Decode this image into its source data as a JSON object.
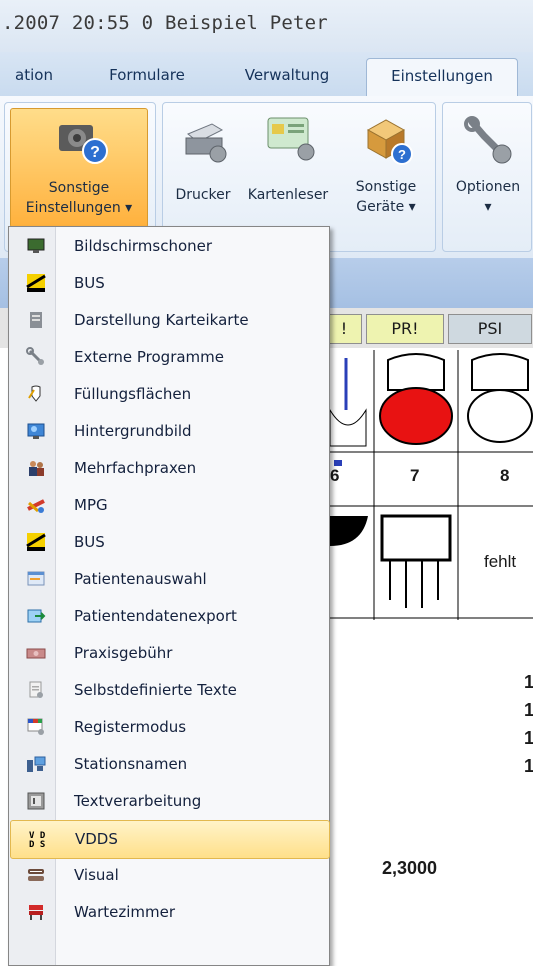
{
  "title_bar": {
    "text": ".2007   20:55  0  Beispiel Peter"
  },
  "tabs": [
    {
      "label": "ation",
      "active": false
    },
    {
      "label": "Formulare",
      "active": false
    },
    {
      "label": "Verwaltung",
      "active": false
    },
    {
      "label": "Einstellungen",
      "active": true
    }
  ],
  "ribbon": {
    "sonstige_einstellungen": {
      "line1": "Sonstige",
      "line2": "Einstellungen ▾",
      "icon": "gear-help-icon"
    },
    "drucker": {
      "label": "Drucker",
      "icon": "printer-gear-icon"
    },
    "kartenleser": {
      "label": "Kartenleser",
      "icon": "card-reader-icon"
    },
    "sonstige_geraete": {
      "line1": "Sonstige",
      "line2": "Geräte ▾",
      "icon": "device-box-icon"
    },
    "optionen": {
      "line1": "Optionen",
      "line2": "▾",
      "icon": "wrench-gear-icon"
    }
  },
  "background": {
    "pills": [
      "!",
      "PR!",
      "PSI"
    ],
    "tooth_numbers": [
      "6",
      "7",
      "8"
    ],
    "fehlt": "fehlt",
    "value_left": "2,3000",
    "right_digits": [
      "1",
      "1",
      "1",
      "1"
    ]
  },
  "menu": {
    "items": [
      {
        "label": "Bildschirmschoner",
        "icon": "monitor-icon"
      },
      {
        "label": "BUS",
        "icon": "bus-icon"
      },
      {
        "label": "Darstellung Karteikarte",
        "icon": "card-file-icon"
      },
      {
        "label": "Externe Programme",
        "icon": "wrench-icon"
      },
      {
        "label": "Füllungsflächen",
        "icon": "tooth-fill-icon"
      },
      {
        "label": "Hintergrundbild",
        "icon": "picture-icon"
      },
      {
        "label": "Mehrfachpraxen",
        "icon": "people-icon"
      },
      {
        "label": "MPG",
        "icon": "tools-icon"
      },
      {
        "label": "BUS",
        "icon": "bus-icon"
      },
      {
        "label": "Patientenauswahl",
        "icon": "patient-select-icon"
      },
      {
        "label": "Patientendatenexport",
        "icon": "export-icon"
      },
      {
        "label": "Praxisgebühr",
        "icon": "banknote-icon"
      },
      {
        "label": "Selbstdefinierte Texte",
        "icon": "text-page-icon"
      },
      {
        "label": "Registermodus",
        "icon": "register-icon"
      },
      {
        "label": "Stationsnamen",
        "icon": "station-icon"
      },
      {
        "label": "Textverarbeitung",
        "icon": "word-processor-icon"
      },
      {
        "label": "VDDS",
        "icon": "vdds-icon",
        "highlighted": true
      },
      {
        "label": "Visual",
        "icon": "visual-icon"
      },
      {
        "label": "Wartezimmer",
        "icon": "waiting-room-icon"
      }
    ]
  }
}
